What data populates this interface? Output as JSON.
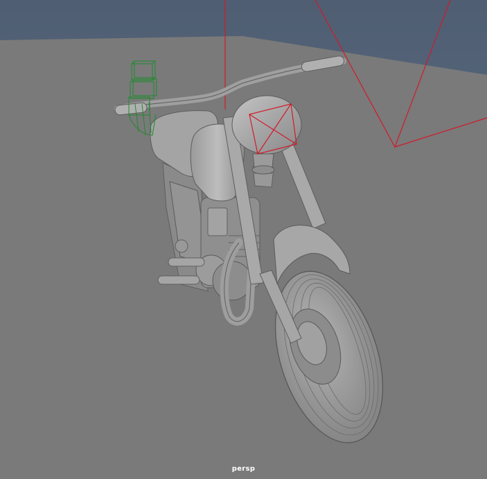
{
  "viewport": {
    "camera_name": "persp"
  },
  "scene": {
    "background_color": "#5b6b7f",
    "ground_color": "#7a7a7a",
    "model_color": "#9a9a9a",
    "selection_color": "#1f8a2e",
    "camera_gizmo_color": "#d11a2a"
  }
}
